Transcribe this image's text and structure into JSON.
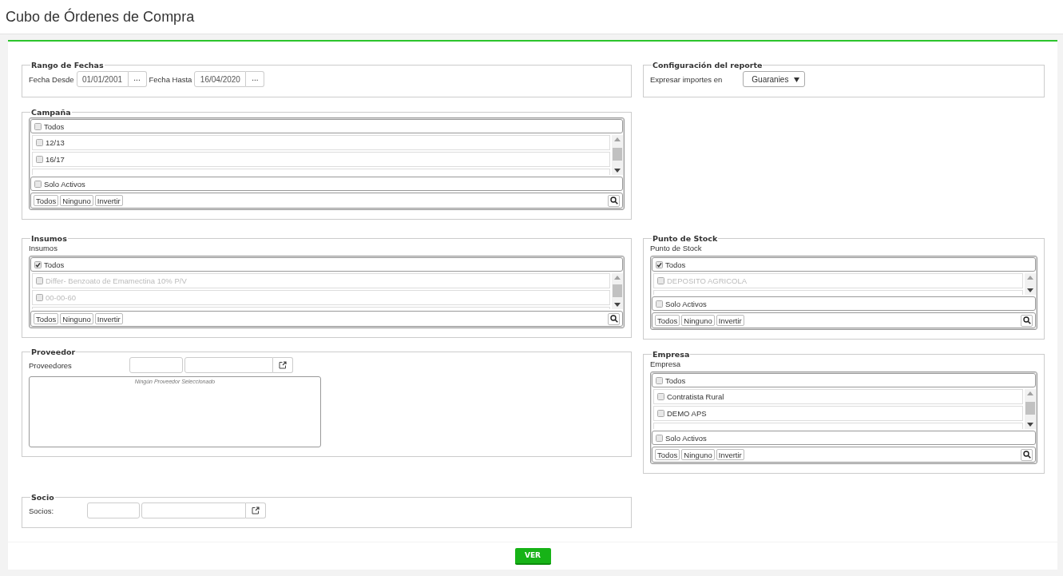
{
  "page_title": "Cubo de Órdenes de Compra",
  "date_range": {
    "legend": "Rango de Fechas",
    "from": {
      "label": "Fecha Desde",
      "value": "01/01/2001",
      "button": "..."
    },
    "to": {
      "label": "Fecha Hasta",
      "value": "16/04/2020",
      "button": "..."
    }
  },
  "report_config": {
    "legend": "Configuración del reporte",
    "label": "Expresar importes en",
    "select": {
      "value": "Guaranies"
    }
  },
  "campaign": {
    "legend": "Campaña",
    "list": {
      "all": {
        "label": "Todos",
        "checked": false
      },
      "items": [
        {
          "label": "12/13",
          "checked": false,
          "disabled": false
        },
        {
          "label": "16/17",
          "checked": false,
          "disabled": false
        }
      ],
      "active_only": {
        "label": "Solo Activos",
        "checked": false
      },
      "actions": [
        "Todos",
        "Ninguno",
        "Invertir"
      ]
    }
  },
  "supplies": {
    "legend": "Insumos",
    "field_label": "Insumos",
    "list": {
      "all": {
        "label": "Todos",
        "checked": true
      },
      "items": [
        {
          "label": "Differ- Benzoato de Emamectina 10% P/V",
          "checked": false,
          "disabled": true
        },
        {
          "label": "00-00-60",
          "checked": false,
          "disabled": true
        }
      ],
      "actions": [
        "Todos",
        "Ninguno",
        "Invertir"
      ]
    }
  },
  "stock_point": {
    "legend": "Punto de Stock",
    "field_label": "Punto de Stock",
    "list": {
      "all": {
        "label": "Todos",
        "checked": true
      },
      "items": [
        {
          "label": "DEPOSITO AGRICOLA",
          "checked": false,
          "disabled": true
        }
      ],
      "active_only": {
        "label": "Solo Activos",
        "checked": false
      },
      "actions": [
        "Todos",
        "Ninguno",
        "Invertir"
      ]
    }
  },
  "supplier": {
    "legend": "Proveedor",
    "label": "Proveedores",
    "empty_message": "Ningún Proveedor Seleccionado"
  },
  "company": {
    "legend": "Empresa",
    "field_label": "Empresa",
    "list": {
      "all": {
        "label": "Todos",
        "checked": false
      },
      "items": [
        {
          "label": "Contratista Rural",
          "checked": false,
          "disabled": false
        },
        {
          "label": "DEMO APS",
          "checked": false,
          "disabled": false
        }
      ],
      "active_only": {
        "label": "Solo Activos",
        "checked": false
      },
      "actions": [
        "Todos",
        "Ninguno",
        "Invertir"
      ]
    }
  },
  "partner": {
    "legend": "Socio",
    "label": "Socios:"
  },
  "submit_button": "VER"
}
